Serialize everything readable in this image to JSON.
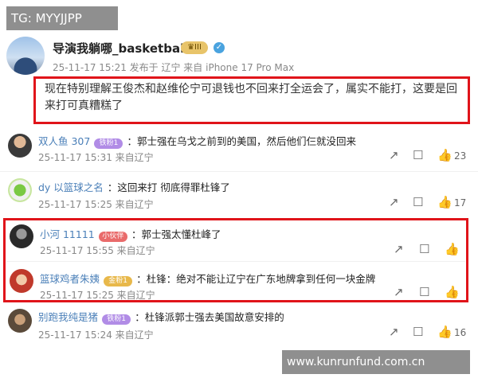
{
  "watermark_top": "TG: MYYJJPP",
  "watermark_bottom": "www.kunrunfund.com.cn",
  "post": {
    "author": "导演我躺哪_basketball",
    "vip_badge": "III",
    "meta": "25-11-17 15:21 发布于 辽宁  来自 iPhone 17 Pro Max",
    "text": "现在特别理解王俊杰和赵维伦宁可退钱也不回来打全运会了，属实不能打，这要是回来打可真糟糕了"
  },
  "comments": [
    {
      "name": "双人鱼 307",
      "badge": "铁粉1",
      "badge_color": "#b18ce6",
      "text": "：郭士强在乌戈之前到的美国，然后他们仨就没回来",
      "meta": "25-11-17 15:31 来自辽宁",
      "likes": "23"
    },
    {
      "name": "dy 以篮球之名",
      "badge": "",
      "badge_color": "",
      "text": "：这回来打 彻底得罪杜锋了",
      "meta": "25-11-17 15:25 来自辽宁",
      "likes": "17"
    },
    {
      "name": "小河 11111",
      "badge": "小伙伴",
      "badge_color": "#e96b6b",
      "text": "：郭士强太懂杜峰了",
      "meta": "25-11-17 15:55 来自辽宁",
      "likes": ""
    },
    {
      "name": "篮球鸡者朱姨",
      "badge": "金粉1",
      "badge_color": "#e8b84a",
      "text": "：杜锋：绝对不能让辽宁在广东地牌拿到任何一块金牌",
      "meta": "25-11-17 15:25 来自辽宁",
      "likes": ""
    },
    {
      "name": "别跑我纯是猪",
      "badge": "铁粉1",
      "badge_color": "#b18ce6",
      "text": "：杜锋派郭士强去美国故意安排的",
      "meta": "25-11-17 15:24 来自辽宁",
      "likes": "16"
    }
  ]
}
